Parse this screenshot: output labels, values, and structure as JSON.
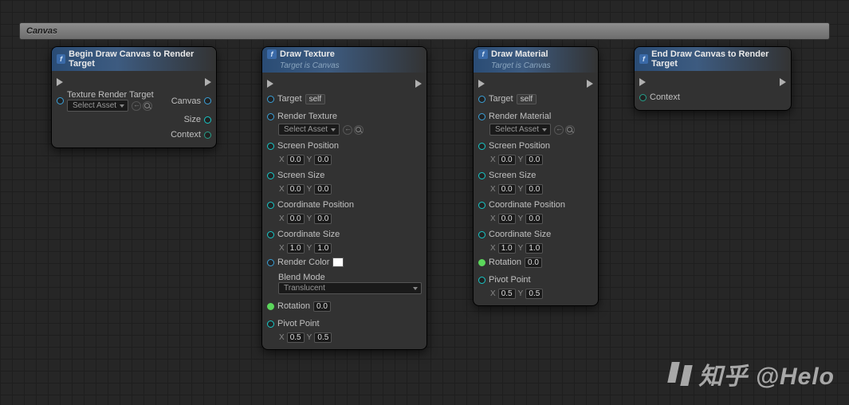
{
  "category": "Canvas",
  "watermark": "知乎 @Helo",
  "nodes": {
    "begin": {
      "title": "Begin Draw Canvas to Render Target",
      "inputs": [
        {
          "label": "Texture Render Target",
          "asset_dropdown": "Select Asset"
        }
      ],
      "outputs": [
        {
          "label": "Canvas"
        },
        {
          "label": "Size"
        },
        {
          "label": "Context"
        }
      ]
    },
    "drawTexture": {
      "title": "Draw Texture",
      "subtitle": "Target is Canvas",
      "target": {
        "label": "Target",
        "value": "self"
      },
      "renderTexture": {
        "label": "Render Texture",
        "asset_dropdown": "Select Asset"
      },
      "screenPosition": {
        "label": "Screen Position",
        "x": "0.0",
        "y": "0.0"
      },
      "screenSize": {
        "label": "Screen Size",
        "x": "0.0",
        "y": "0.0"
      },
      "coordinatePosition": {
        "label": "Coordinate Position",
        "x": "0.0",
        "y": "0.0"
      },
      "coordinateSize": {
        "label": "Coordinate Size",
        "x": "1.0",
        "y": "1.0"
      },
      "renderColor": {
        "label": "Render Color",
        "swatch": "#ffffff"
      },
      "blendMode": {
        "label": "Blend Mode",
        "value": "Translucent"
      },
      "rotation": {
        "label": "Rotation",
        "value": "0.0"
      },
      "pivotPoint": {
        "label": "Pivot Point",
        "x": "0.5",
        "y": "0.5"
      }
    },
    "drawMaterial": {
      "title": "Draw Material",
      "subtitle": "Target is Canvas",
      "target": {
        "label": "Target",
        "value": "self"
      },
      "renderMaterial": {
        "label": "Render Material",
        "asset_dropdown": "Select Asset"
      },
      "screenPosition": {
        "label": "Screen Position",
        "x": "0.0",
        "y": "0.0"
      },
      "screenSize": {
        "label": "Screen Size",
        "x": "0.0",
        "y": "0.0"
      },
      "coordinatePosition": {
        "label": "Coordinate Position",
        "x": "0.0",
        "y": "0.0"
      },
      "coordinateSize": {
        "label": "Coordinate Size",
        "x": "1.0",
        "y": "1.0"
      },
      "rotation": {
        "label": "Rotation",
        "value": "0.0"
      },
      "pivotPoint": {
        "label": "Pivot Point",
        "x": "0.5",
        "y": "0.5"
      }
    },
    "end": {
      "title": "End Draw Canvas to Render Target",
      "inputs": [
        {
          "label": "Context"
        }
      ]
    }
  }
}
